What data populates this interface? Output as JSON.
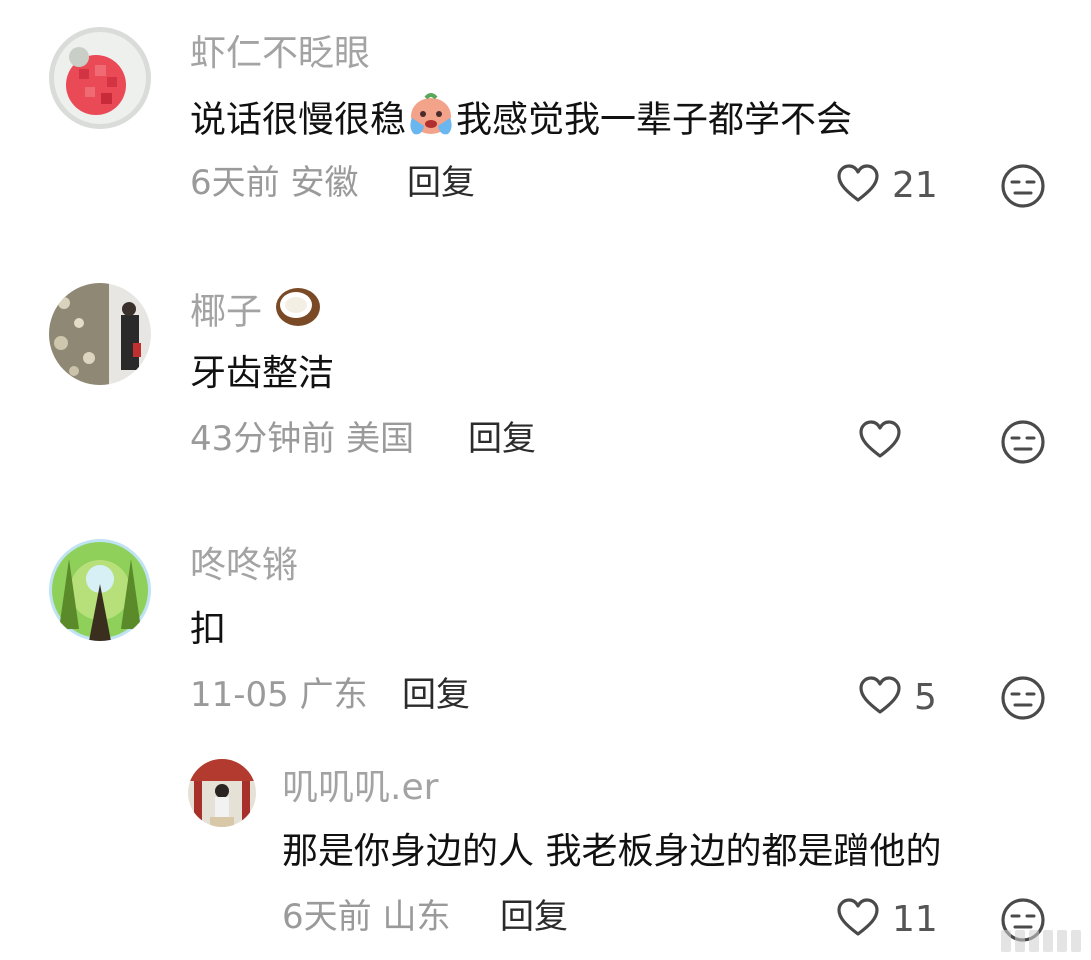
{
  "comments": [
    {
      "username": "虾仁不眨眼",
      "content_a": "说话很慢很稳",
      "content_b": "我感觉我一辈子都学不会",
      "inline_emoji": "crying-face-emoji",
      "time": "6天前",
      "location": "安徽",
      "reply_label": "回复",
      "likes": "21"
    },
    {
      "username": "椰子",
      "username_emoji": "coconut-emoji",
      "content": "牙齿整洁",
      "time": "43分钟前",
      "location": "美国",
      "reply_label": "回复",
      "likes": ""
    },
    {
      "username": "咚咚锵",
      "content": "扣",
      "time": "11-05",
      "location": "广东",
      "reply_label": "回复",
      "likes": "5"
    }
  ],
  "nested_reply": {
    "username": "叽叽叽.er",
    "content": "那是你身边的人 我老板身边的都是蹭他的",
    "time": "6天前",
    "location": "山东",
    "reply_label": "回复",
    "likes": "11"
  },
  "colors": {
    "username": "#a3a3a3",
    "content": "#111111",
    "meta": "#9a9a9a",
    "reply": "#2b2b2b",
    "icon": "#4a4a4a"
  }
}
